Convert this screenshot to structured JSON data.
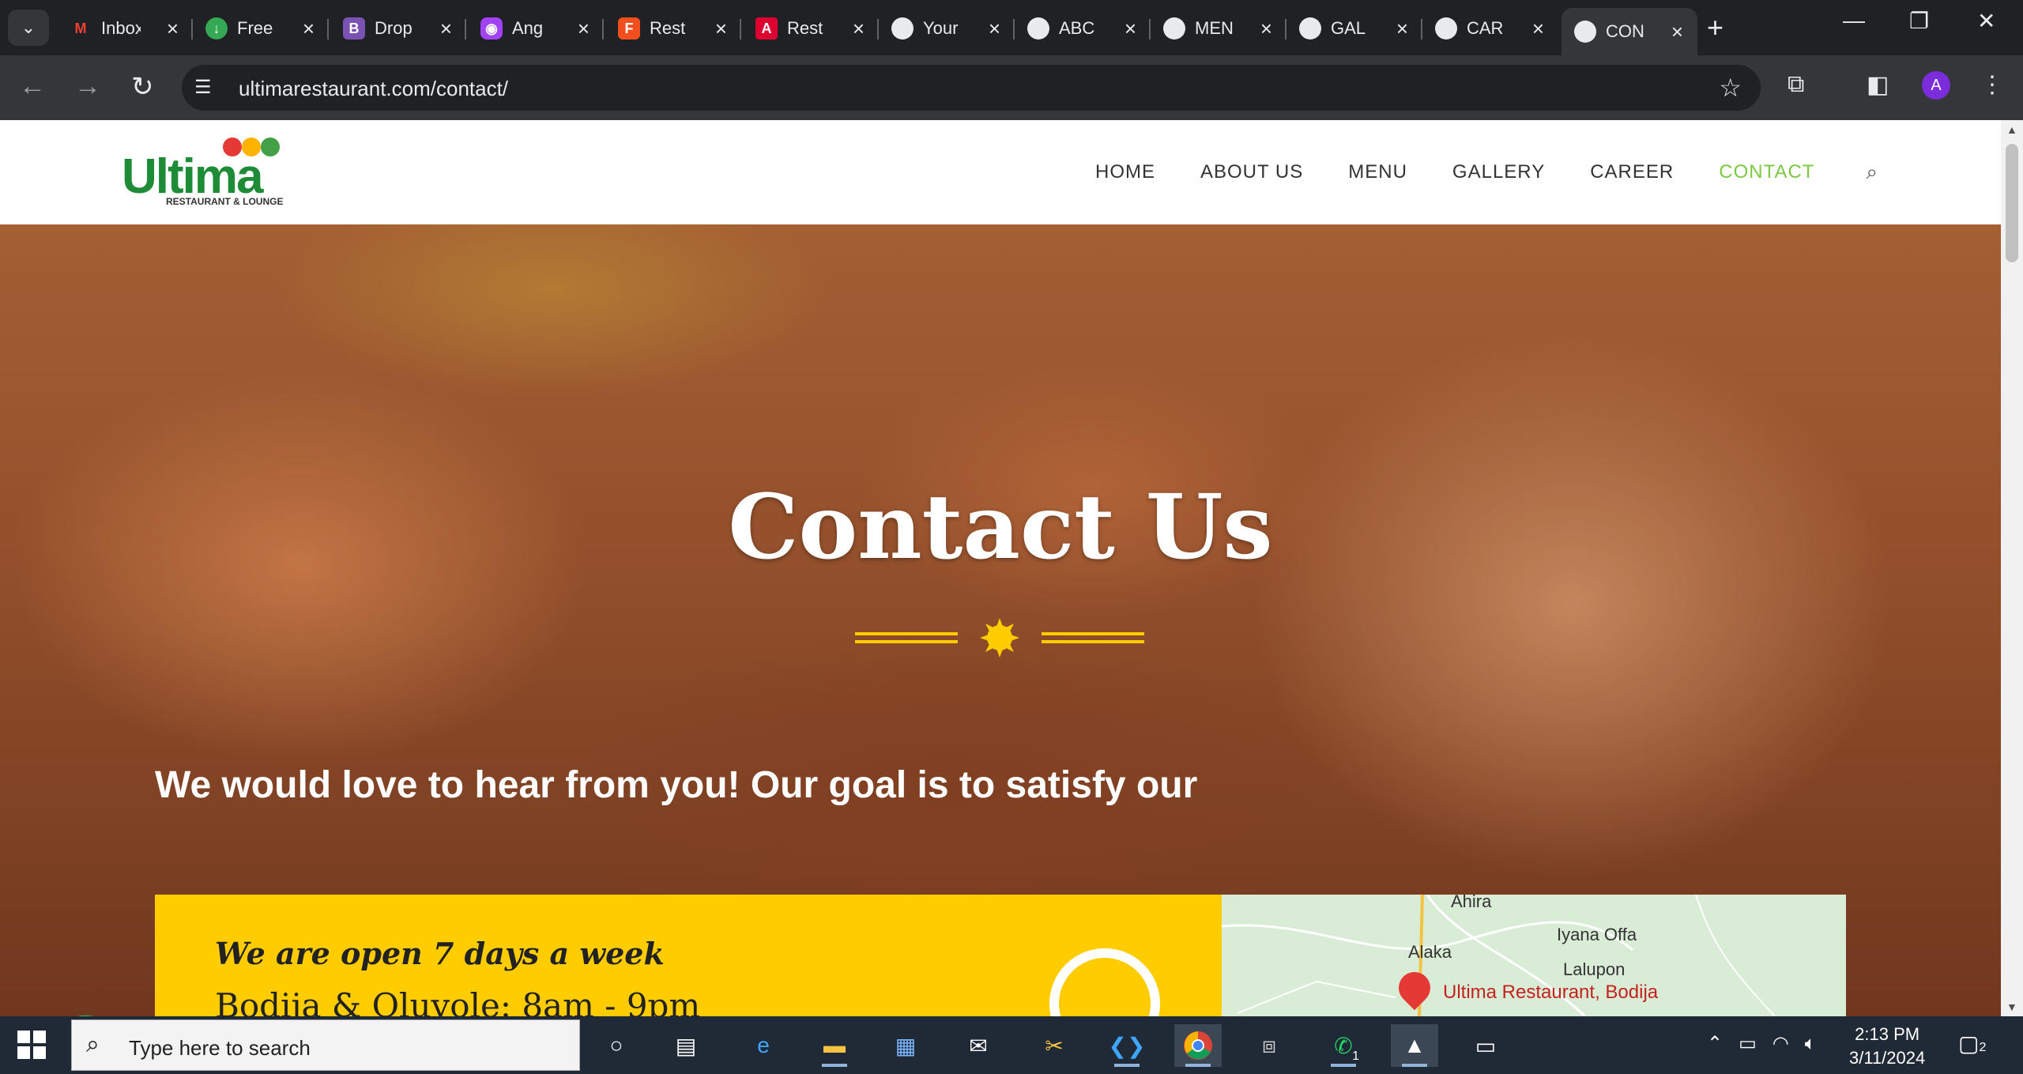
{
  "tabs": [
    {
      "title": "Inbox",
      "favicon": "gmail-icon",
      "color": "#ea4335"
    },
    {
      "title": "Free",
      "favicon": "download-icon",
      "color": "#34a853"
    },
    {
      "title": "Drop",
      "favicon": "bootstrap-icon",
      "color": "#7952b3"
    },
    {
      "title": "Ang",
      "favicon": "chat-bot-icon",
      "color": "#a142f4"
    },
    {
      "title": "Rest",
      "favicon": "figma-icon",
      "color": "#f24e1e"
    },
    {
      "title": "Rest",
      "favicon": "angular-icon",
      "color": "#dd0031"
    },
    {
      "title": "Your",
      "favicon": "ultima-favicon",
      "color": "#e8eaed"
    },
    {
      "title": "ABC",
      "favicon": "ultima-favicon",
      "color": "#e8eaed"
    },
    {
      "title": "MEN",
      "favicon": "ultima-favicon",
      "color": "#e8eaed"
    },
    {
      "title": "GAL",
      "favicon": "ultima-favicon",
      "color": "#e8eaed"
    },
    {
      "title": "CAR",
      "favicon": "ultima-favicon",
      "color": "#e8eaed"
    },
    {
      "title": "CON",
      "favicon": "ultima-favicon",
      "color": "#e8eaed"
    }
  ],
  "toolbar": {
    "url": "ultimarestaurant.com/contact/",
    "profile_initial": "A"
  },
  "site": {
    "logo_word": "Ultima",
    "logo_sub": "RESTAURANT & LOUNGE",
    "nav": [
      "HOME",
      "ABOUT US",
      "MENU",
      "GALLERY",
      "CAREER",
      "CONTACT"
    ],
    "active_nav": "CONTACT",
    "accent": "#7ac943"
  },
  "hero": {
    "title": "Contact Us",
    "subtitle": "We would love to hear from you! Our goal is to satisfy our ",
    "divider_color": "#ffcc00"
  },
  "hours": {
    "title": "We are open 7 days a week",
    "line": "Bodija & Oluyole: 8am - 9pm",
    "card_color": "#ffcc00"
  },
  "map": {
    "labels": [
      "Ahira",
      "Iyana Offa",
      "Alaka",
      "Lalupon"
    ],
    "pin_label": "Ultima Restaurant, Bodija"
  },
  "taskbar": {
    "search_placeholder": "Type here to search",
    "time": "2:13 PM",
    "date": "3/11/2024",
    "whatsapp_badge": "1",
    "notification_count": "2"
  }
}
